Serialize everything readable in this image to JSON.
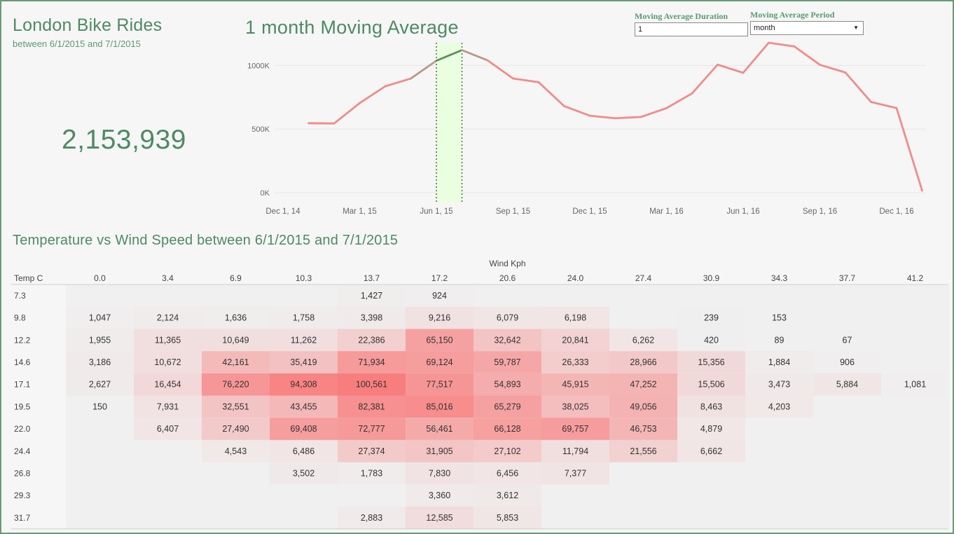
{
  "kpi": {
    "title": "London Bike Rides",
    "subtitle": "between 6/1/2015 and 7/1/2015",
    "value": "2,153,939"
  },
  "controls": {
    "duration_label": "Moving Average Duration",
    "duration_value": "1",
    "period_label": "Moving Average Period",
    "period_value": "month"
  },
  "colors": {
    "brand_green": "#4e8a63",
    "line": "#f28b8b",
    "highlight_line": "#5a8f5e",
    "selection_band": "#eaffdf",
    "heat_max": "#f87e7e"
  },
  "chart_data": [
    {
      "type": "line",
      "title": "1 month Moving Average",
      "x": [
        "Jan 1, 15",
        "Feb 1, 15",
        "Mar 1, 15",
        "Apr 1, 15",
        "May 1, 15",
        "Jun 1, 15",
        "Jul 1, 15",
        "Aug 1, 15",
        "Sep 1, 15",
        "Oct 1, 15",
        "Nov 1, 15",
        "Dec 1, 15",
        "Jan 1, 16",
        "Feb 1, 16",
        "Mar 1, 16",
        "Apr 1, 16",
        "May 1, 16",
        "Jun 1, 16",
        "Jul 1, 16",
        "Aug 1, 16",
        "Sep 1, 16",
        "Oct 1, 16",
        "Nov 1, 16",
        "Dec 1, 16",
        "Jan 1, 17"
      ],
      "values": [
        546000,
        544000,
        704000,
        836000,
        897000,
        1037000,
        1120000,
        1040000,
        897000,
        868000,
        680000,
        605000,
        585000,
        595000,
        664000,
        780000,
        1006000,
        942000,
        1178000,
        1149000,
        1005000,
        944000,
        713000,
        665000,
        17000
      ],
      "x_ticks": [
        "Dec 1, 14",
        "Mar 1, 15",
        "Jun 1, 15",
        "Sep 1, 15",
        "Dec 1, 15",
        "Mar 1, 16",
        "Jun 1, 16",
        "Sep 1, 16",
        "Dec 1, 16"
      ],
      "y_ticks": [
        "0K",
        "500K",
        "1000K"
      ],
      "ylim": [
        0,
        1200000
      ],
      "selected_range": [
        "Jun 1, 15",
        "Jul 1, 15"
      ],
      "grid": true
    },
    {
      "type": "heatmap",
      "title": "Temperature vs Wind Speed between 6/1/2015 and 7/1/2015",
      "xlabel": "Wind Kph",
      "row_header": "Temp C",
      "columns": [
        "0.0",
        "3.4",
        "6.9",
        "10.3",
        "13.7",
        "17.2",
        "20.6",
        "24.0",
        "27.4",
        "30.9",
        "34.3",
        "37.7",
        "41.2"
      ],
      "rows": [
        {
          "label": "7.3",
          "values": [
            null,
            null,
            null,
            null,
            1427,
            924,
            null,
            null,
            null,
            null,
            null,
            null,
            null
          ]
        },
        {
          "label": "9.8",
          "values": [
            1047,
            2124,
            1636,
            1758,
            3398,
            9216,
            6079,
            6198,
            null,
            239,
            153,
            null,
            null
          ]
        },
        {
          "label": "12.2",
          "values": [
            1955,
            11365,
            10649,
            11262,
            22386,
            65150,
            32642,
            20841,
            6262,
            420,
            89,
            67,
            null
          ]
        },
        {
          "label": "14.6",
          "values": [
            3186,
            10672,
            42161,
            35419,
            71934,
            69124,
            59787,
            26333,
            28966,
            15356,
            1884,
            906,
            null
          ]
        },
        {
          "label": "17.1",
          "values": [
            2627,
            16454,
            76220,
            94308,
            100561,
            77517,
            54893,
            45915,
            47252,
            15506,
            3473,
            5884,
            1081
          ]
        },
        {
          "label": "19.5",
          "values": [
            150,
            7931,
            32551,
            43455,
            82381,
            85016,
            65279,
            38025,
            49056,
            8463,
            4203,
            null,
            null
          ]
        },
        {
          "label": "22.0",
          "values": [
            null,
            6407,
            27490,
            69408,
            72777,
            56461,
            66128,
            69757,
            46753,
            4879,
            null,
            null,
            null
          ]
        },
        {
          "label": "24.4",
          "values": [
            null,
            null,
            4543,
            6486,
            27374,
            31905,
            27102,
            11794,
            21556,
            6662,
            null,
            null,
            null
          ]
        },
        {
          "label": "26.8",
          "values": [
            null,
            null,
            null,
            3502,
            1783,
            7830,
            6456,
            7377,
            null,
            null,
            null,
            null,
            null
          ]
        },
        {
          "label": "29.3",
          "values": [
            null,
            null,
            null,
            null,
            null,
            3360,
            3612,
            null,
            null,
            null,
            null,
            null,
            null
          ]
        },
        {
          "label": "31.7",
          "values": [
            null,
            null,
            null,
            null,
            2883,
            12585,
            5853,
            null,
            null,
            null,
            null,
            null,
            null
          ]
        }
      ]
    }
  ]
}
